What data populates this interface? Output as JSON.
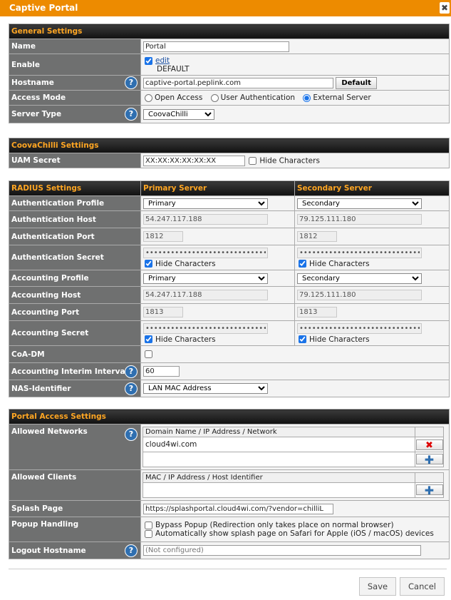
{
  "window": {
    "title": "Captive Portal",
    "close_glyph": "✖"
  },
  "general": {
    "header": "General Settings",
    "name_label": "Name",
    "name_value": "Portal",
    "enable_label": "Enable",
    "enable_edit": "edit",
    "enable_default": "DEFAULT",
    "hostname_label": "Hostname",
    "hostname_value": "captive-portal.peplink.com",
    "default_btn": "Default",
    "access_mode_label": "Access Mode",
    "access_open": "Open Access",
    "access_user": "User Authentication",
    "access_external": "External Server",
    "server_type_label": "Server Type",
    "server_type_value": "CoovaChilli"
  },
  "coova": {
    "header": "CoovaChilli Settiings",
    "uam_label": "UAM Secret",
    "uam_value": "XX:XX:XX:XX:XX:XX",
    "hide_chars": "Hide Characters"
  },
  "radius": {
    "header": "RADIUS Settings",
    "primary_header": "Primary Server",
    "secondary_header": "Secondary Server",
    "auth_profile_label": "Authentication Profile",
    "primary_option": "Primary",
    "secondary_option": "Secondary",
    "auth_host_label": "Authentication Host",
    "auth_host_primary": "54.247.117.188",
    "auth_host_secondary": "79.125.111.180",
    "auth_port_label": "Authentication Port",
    "auth_port_primary": "1812",
    "auth_port_secondary": "1812",
    "auth_secret_label": "Authentication Secret",
    "secret_mask": "••••••••••••••••••••••••••••••••",
    "hide_chars": "Hide Characters",
    "acct_profile_label": "Accounting Profile",
    "acct_host_label": "Accounting Host",
    "acct_host_primary": "54.247.117.188",
    "acct_host_secondary": "79.125.111.180",
    "acct_port_label": "Accounting Port",
    "acct_port_primary": "1813",
    "acct_port_secondary": "1813",
    "acct_secret_label": "Accounting Secret",
    "coa_label": "CoA-DM",
    "interim_label": "Accounting Interim Interval",
    "interim_value": "60",
    "nas_label": "NAS-Identifier",
    "nas_value": "LAN MAC Address"
  },
  "portal": {
    "header": "Portal Access Settings",
    "allowed_networks_label": "Allowed Networks",
    "networks_col": "Domain Name / IP Address / Network",
    "networks_rows": [
      "cloud4wi.com"
    ],
    "allowed_clients_label": "Allowed Clients",
    "clients_col": "MAC / IP Address / Host Identifier",
    "splash_label": "Splash Page",
    "splash_value": "https://splashportal.cloud4wi.com/?vendor=chilliL",
    "popup_label": "Popup Handling",
    "popup_bypass": "Bypass Popup (Redirection only takes place on normal browser)",
    "popup_auto": "Automatically show splash page on Safari for Apple (iOS / macOS) devices",
    "logout_label": "Logout Hostname",
    "logout_placeholder": "(Not configured)"
  },
  "footer": {
    "save": "Save",
    "cancel": "Cancel"
  },
  "icons": {
    "help": "?",
    "remove": "✖",
    "add": "✚"
  },
  "colors": {
    "titlebar": "#ed8b00",
    "section_header_text": "#ffa623",
    "label_bg": "#6f7070",
    "help_icon": "#2f6fb0"
  }
}
